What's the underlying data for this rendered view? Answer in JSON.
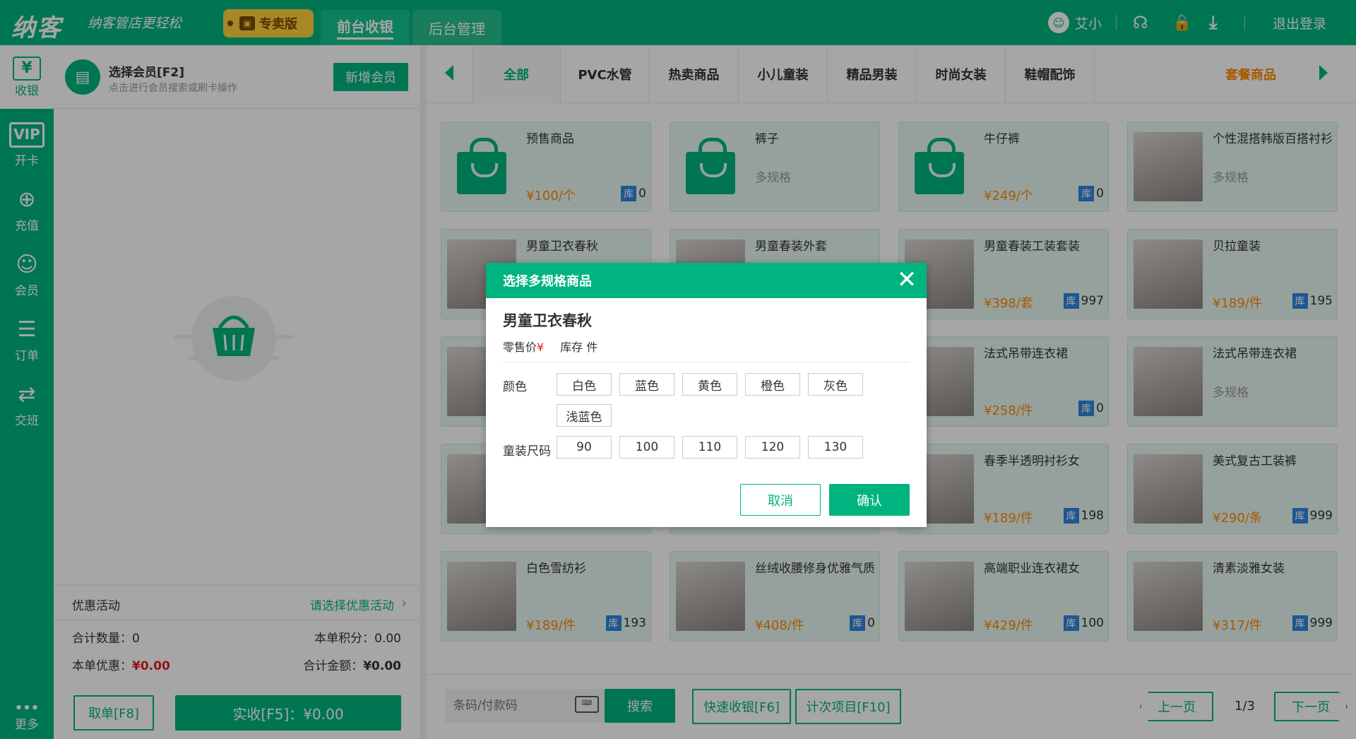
{
  "top": {
    "logo": "纳客",
    "slogan": "纳客管店更轻松",
    "pro": "专卖版",
    "nav": [
      "前台收银",
      "后台管理"
    ],
    "user": "艾小",
    "logout": "退出登录"
  },
  "sidebar": [
    {
      "label": "收银",
      "icon": "cashier-icon",
      "glyph": "¥"
    },
    {
      "label": "开卡",
      "icon": "vip-card-icon",
      "glyph": "VIP"
    },
    {
      "label": "充值",
      "icon": "recharge-icon",
      "glyph": "⊕"
    },
    {
      "label": "会员",
      "icon": "member-icon",
      "glyph": "☺"
    },
    {
      "label": "订单",
      "icon": "order-icon",
      "glyph": "☰"
    },
    {
      "label": "交班",
      "icon": "shift-icon",
      "glyph": "⇄"
    },
    {
      "label": "更多",
      "icon": "more-icon",
      "glyph": "•••"
    }
  ],
  "left": {
    "member_title": "选择会员[F2]",
    "member_sub": "点击进行会员搜索或刷卡操作",
    "add_member": "新增会员",
    "promo_label": "优惠活动",
    "promo_select": "请选择优惠活动",
    "total_qty": "合计数量：0",
    "points": "本单积分：0.00",
    "discount_label": "本单优惠：",
    "discount": "¥0.00",
    "total_label": "合计金额：",
    "total": "¥0.00",
    "cancel_order": "取单[F8]",
    "pay": "实收[F5]：¥0.00"
  },
  "categories": [
    "全部",
    "PVC水管",
    "热卖商品",
    "小儿童装",
    "精品男装",
    "时尚女装",
    "鞋帽配饰",
    "套餐商品"
  ],
  "products": [
    {
      "name": "预售商品",
      "spec": "",
      "price": "¥100/个",
      "stock": "0",
      "thumb": "bag"
    },
    {
      "name": "裤子",
      "spec": "多规格",
      "price": "",
      "stock": "",
      "thumb": "bag"
    },
    {
      "name": "牛仔裤",
      "spec": "",
      "price": "¥249/个",
      "stock": "0",
      "thumb": "bag"
    },
    {
      "name": "个性混搭韩版百搭衬衫",
      "spec": "多规格",
      "price": "",
      "stock": "",
      "thumb": "photo"
    },
    {
      "name": "男童卫衣春秋",
      "spec": "",
      "price": "",
      "stock": "",
      "thumb": "photo"
    },
    {
      "name": "男童春装外套",
      "spec": "",
      "price": "",
      "stock": "",
      "thumb": "photo"
    },
    {
      "name": "男童春装工装套装",
      "spec": "",
      "price": "¥398/套",
      "stock": "997",
      "thumb": "photo"
    },
    {
      "name": "贝拉童装",
      "spec": "",
      "price": "¥189/件",
      "stock": "195",
      "thumb": "photo"
    },
    {
      "name": "",
      "spec": "",
      "price": "",
      "stock": "",
      "thumb": "photo"
    },
    {
      "name": "",
      "spec": "",
      "price": "",
      "stock": "",
      "thumb": "photo"
    },
    {
      "name": "法式吊带连衣裙",
      "spec": "",
      "price": "¥258/件",
      "stock": "0",
      "thumb": "photo"
    },
    {
      "name": "法式吊带连衣裙",
      "spec": "多规格",
      "price": "",
      "stock": "",
      "thumb": "photo"
    },
    {
      "name": "",
      "spec": "",
      "price": "",
      "stock": "",
      "thumb": "photo"
    },
    {
      "name": "",
      "spec": "",
      "price": "",
      "stock": "",
      "thumb": "photo"
    },
    {
      "name": "春季半透明衬衫女",
      "spec": "",
      "price": "¥189/件",
      "stock": "198",
      "thumb": "photo"
    },
    {
      "name": "美式复古工装裤",
      "spec": "",
      "price": "¥290/条",
      "stock": "999",
      "thumb": "photo"
    },
    {
      "name": "白色雪纺衫",
      "spec": "",
      "price": "¥189/件",
      "stock": "193",
      "thumb": "photo"
    },
    {
      "name": "丝绒收腰修身优雅气质",
      "spec": "",
      "price": "¥408/件",
      "stock": "0",
      "thumb": "photo"
    },
    {
      "name": "高端职业连衣裙女",
      "spec": "",
      "price": "¥429/件",
      "stock": "100",
      "thumb": "photo"
    },
    {
      "name": "清素淡雅女装",
      "spec": "",
      "price": "¥317/件",
      "stock": "999",
      "thumb": "photo"
    }
  ],
  "stock_label": "库",
  "bottom": {
    "search_placeholder": "条码/付款码",
    "search": "搜索",
    "quick": "快速收银[F6]",
    "count": "计次项目[F10]",
    "prev": "上一页",
    "page": "1/3",
    "next": "下一页"
  },
  "modal": {
    "title": "选择多规格商品",
    "product": "男童卫衣春秋",
    "retail_label": "零售价",
    "currency": "¥",
    "stock": "库存 件",
    "color_label": "颜色",
    "colors": [
      "白色",
      "蓝色",
      "黄色",
      "橙色",
      "灰色",
      "浅蓝色"
    ],
    "size_label": "童装尺码",
    "sizes": [
      "90",
      "100",
      "110",
      "120",
      "130"
    ],
    "cancel": "取消",
    "confirm": "确认"
  },
  "colors": {
    "brand": "#00b47f",
    "price": "#ff8a00",
    "stock_badge": "#2e86de",
    "discount": "#e51c23"
  }
}
